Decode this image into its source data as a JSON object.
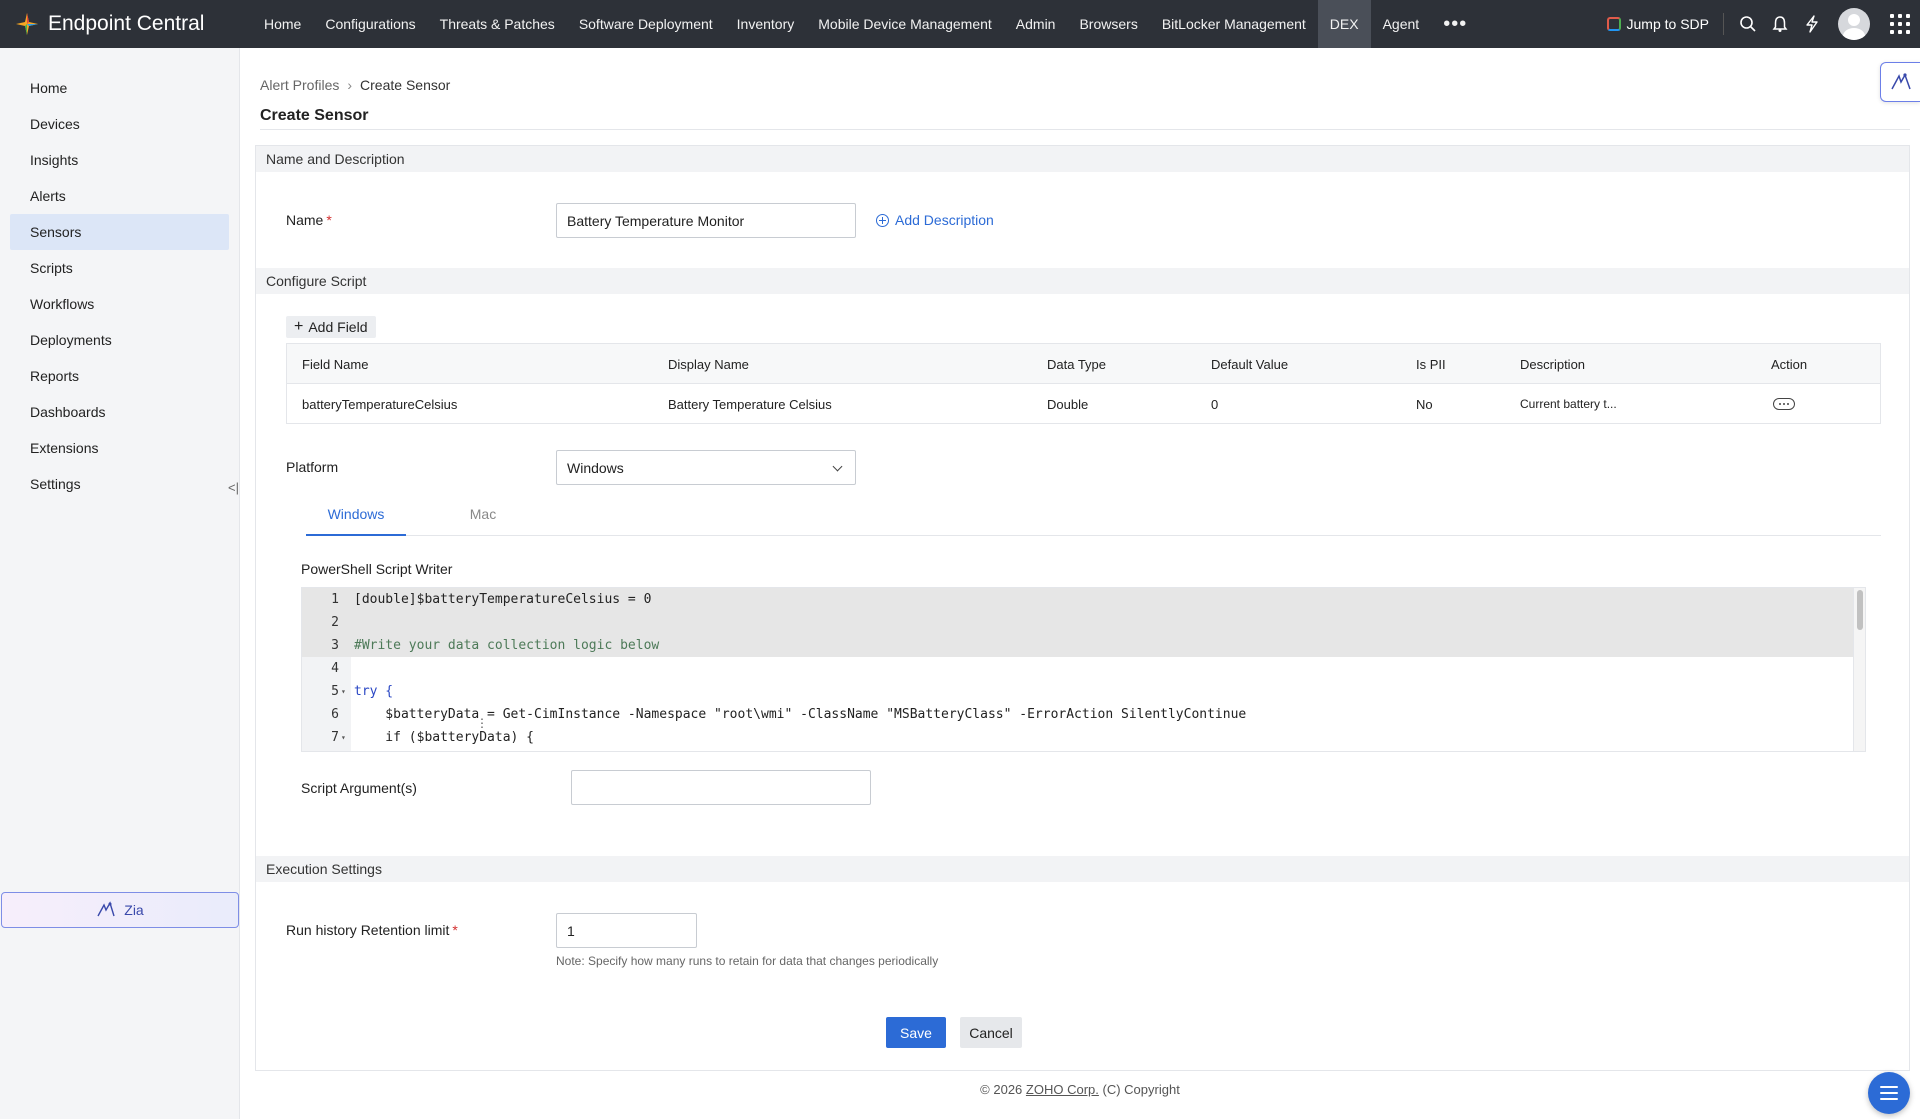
{
  "topbar": {
    "brand": "Endpoint Central",
    "nav": [
      {
        "label": "Home"
      },
      {
        "label": "Configurations"
      },
      {
        "label": "Threats & Patches"
      },
      {
        "label": "Software Deployment"
      },
      {
        "label": "Inventory"
      },
      {
        "label": "Mobile Device Management"
      },
      {
        "label": "Admin"
      },
      {
        "label": "Browsers"
      },
      {
        "label": "BitLocker Management"
      },
      {
        "label": "DEX"
      },
      {
        "label": "Agent"
      }
    ],
    "more": "•••",
    "jump_label": "Jump to SDP"
  },
  "sidebar": {
    "items": [
      {
        "label": "Home"
      },
      {
        "label": "Devices"
      },
      {
        "label": "Insights"
      },
      {
        "label": "Alerts"
      },
      {
        "label": "Sensors"
      },
      {
        "label": "Scripts"
      },
      {
        "label": "Workflows"
      },
      {
        "label": "Deployments"
      },
      {
        "label": "Reports"
      },
      {
        "label": "Dashboards"
      },
      {
        "label": "Extensions"
      },
      {
        "label": "Settings"
      }
    ],
    "zia_label": "Zia"
  },
  "breadcrumb": {
    "parent": "Alert Profiles",
    "current": "Create Sensor"
  },
  "page_title": "Create Sensor",
  "name_section": {
    "header": "Name and Description",
    "name_label": "Name",
    "name_value": "Battery Temperature Monitor",
    "add_description": "Add Description"
  },
  "script_section": {
    "header": "Configure Script",
    "add_field": "Add Field",
    "columns": [
      "Field Name",
      "Display Name",
      "Data Type",
      "Default Value",
      "Is PII",
      "Description",
      "Action"
    ],
    "rows": [
      {
        "field_name": "batteryTemperatureCelsius",
        "display_name": "Battery Temperature Celsius",
        "data_type": "Double",
        "default_value": "0",
        "is_pii": "No",
        "description": "Current battery t..."
      }
    ],
    "platform_label": "Platform",
    "platform_value": "Windows",
    "tabs": [
      {
        "label": "Windows"
      },
      {
        "label": "Mac"
      }
    ],
    "editor_label": "PowerShell Script Writer",
    "code_lines": [
      {
        "num": "1",
        "text": "[double]$batteryTemperatureCelsius = 0"
      },
      {
        "num": "2",
        "text": ""
      },
      {
        "num": "3",
        "text": "#Write your data collection logic below"
      },
      {
        "num": "4",
        "text": ""
      },
      {
        "num": "5",
        "text": "try {"
      },
      {
        "num": "6",
        "text": "    $batteryData = Get-CimInstance -Namespace \"root\\wmi\" -ClassName \"MSBatteryClass\" -ErrorAction SilentlyContinue"
      },
      {
        "num": "7",
        "text": "    if ($batteryData) {"
      }
    ],
    "script_args_label": "Script Argument(s)",
    "script_args_value": ""
  },
  "execution_section": {
    "header": "Execution Settings",
    "retention_label": "Run history Retention limit",
    "retention_value": "1",
    "note": "Note: Specify how many runs to retain for data that changes periodically"
  },
  "actions": {
    "save": "Save",
    "cancel": "Cancel"
  },
  "footer": {
    "prefix": "© 2026",
    "company": "ZOHO Corp.",
    "suffix": "(C) Copyright"
  },
  "colors": {
    "topbar": "#2d3138",
    "accent": "#2c6bd6",
    "sidebar_active": "#dce6f7",
    "required": "#d32f2f"
  }
}
